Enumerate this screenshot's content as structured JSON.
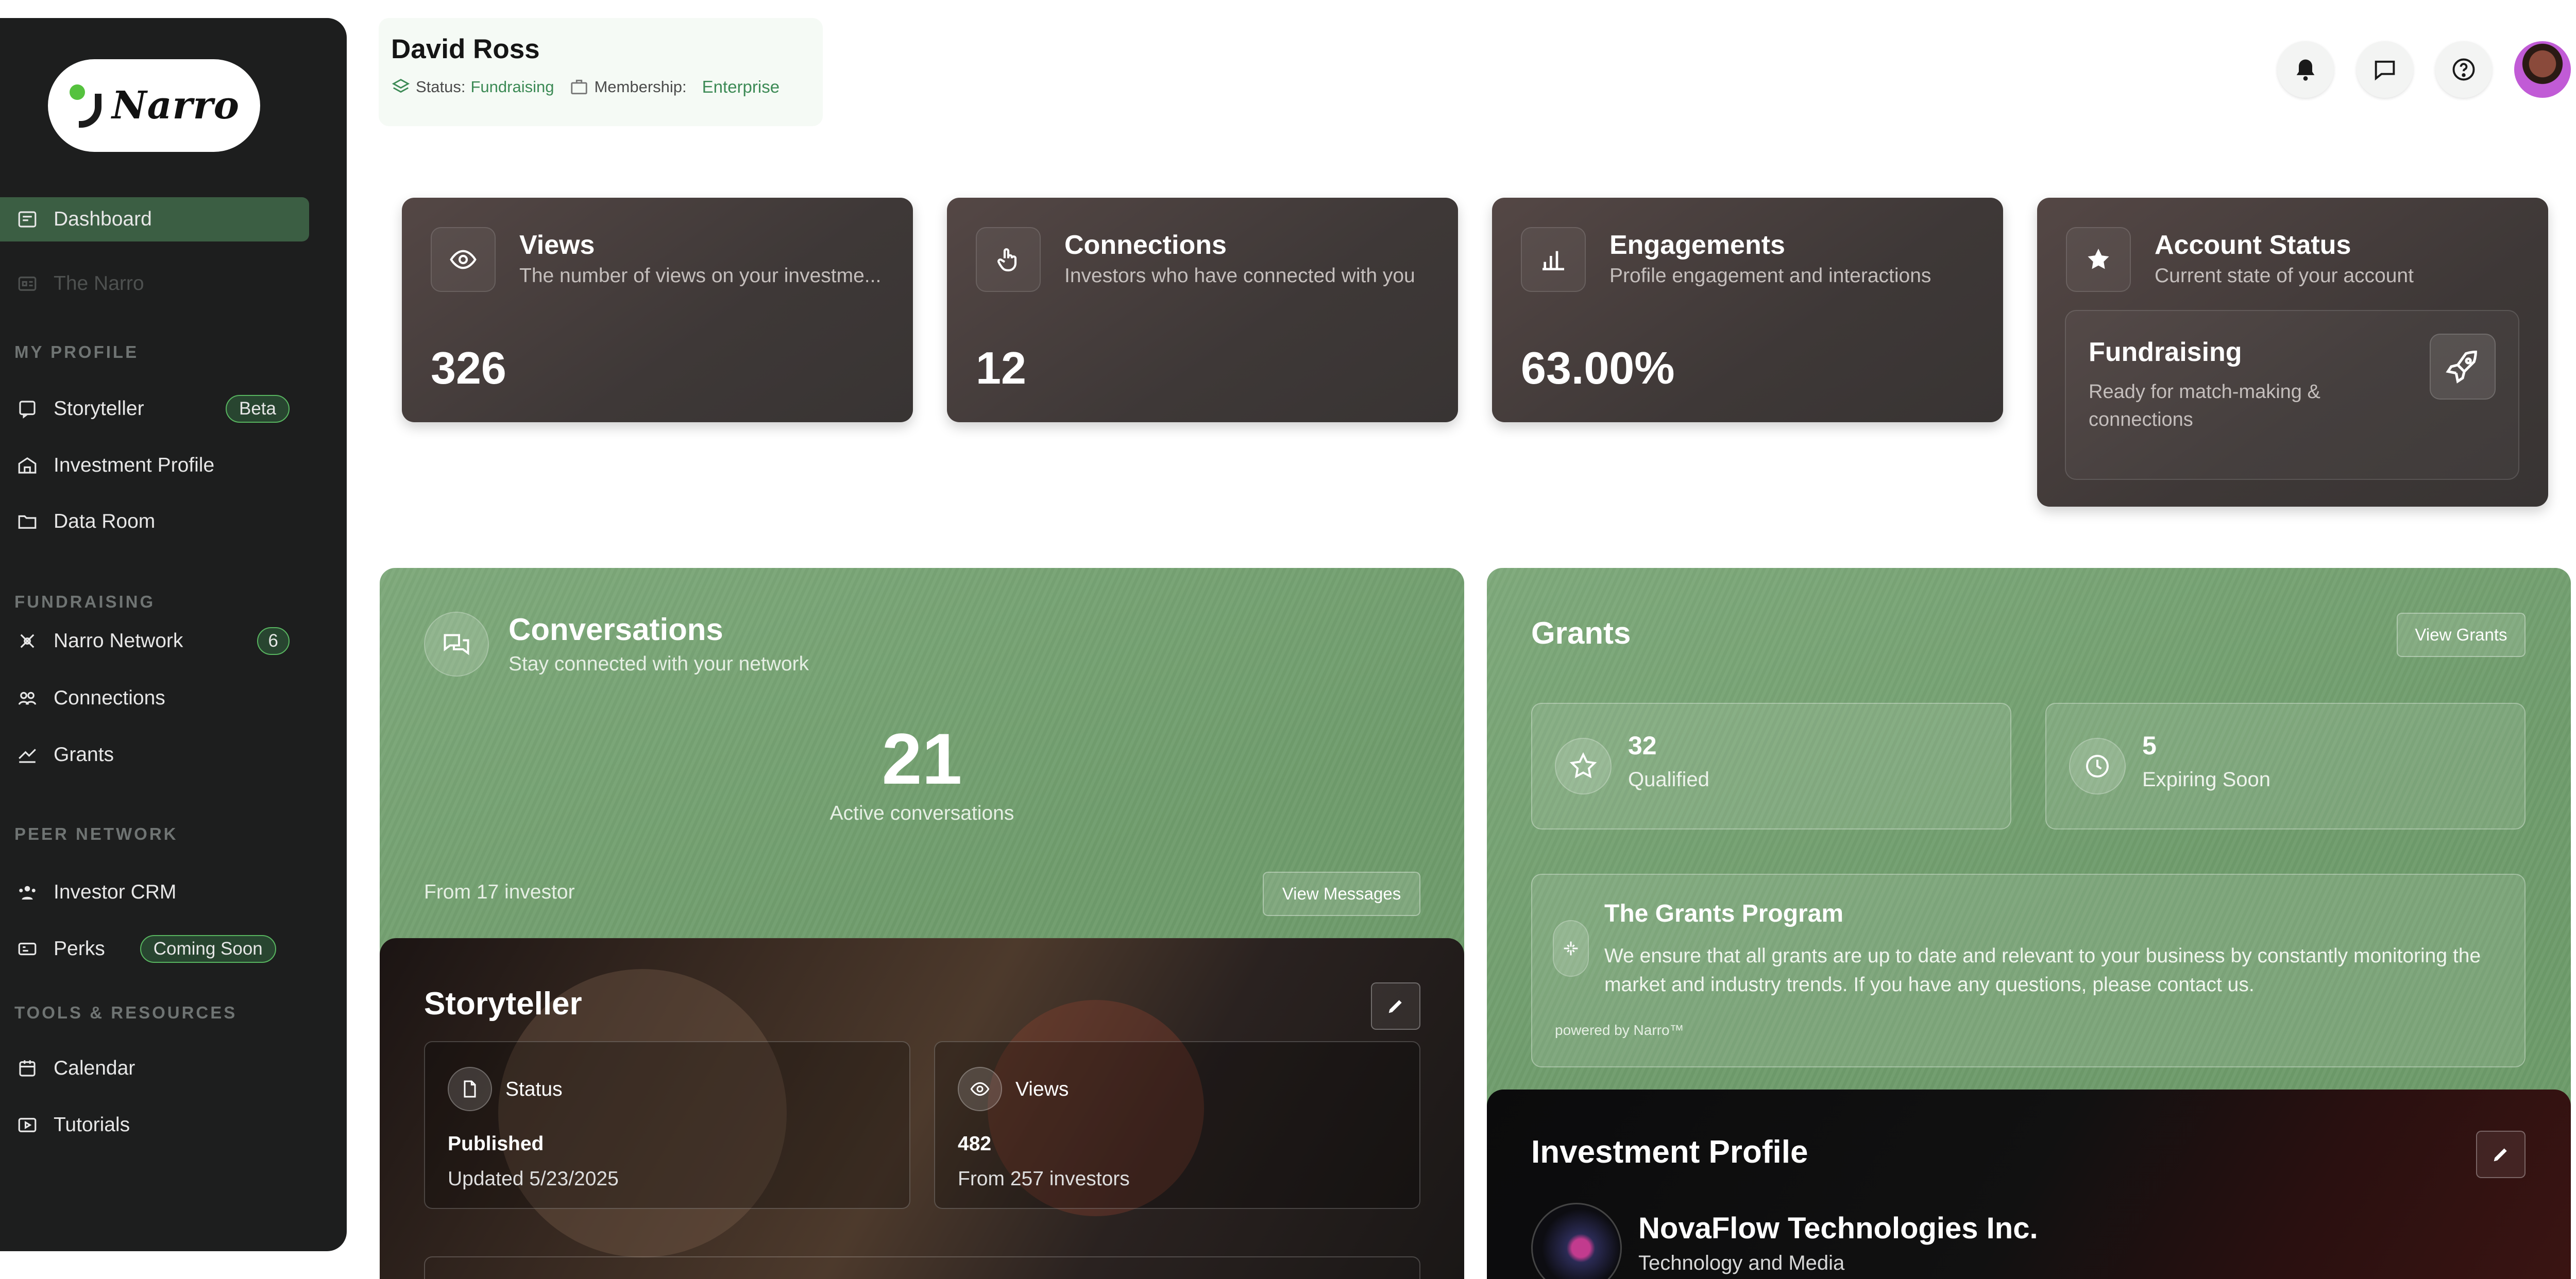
{
  "app": {
    "brand": "Narro"
  },
  "sidebar": {
    "nav": [
      {
        "label": "Dashboard",
        "icon": "dashboard-icon"
      },
      {
        "label": "The Narro",
        "icon": "narro-icon"
      }
    ],
    "sections": [
      {
        "title": "MY PROFILE",
        "items": [
          {
            "label": "Storyteller",
            "icon": "storyteller-icon",
            "badge": "Beta"
          },
          {
            "label": "Investment Profile",
            "icon": "building-icon"
          },
          {
            "label": "Data Room",
            "icon": "folder-icon"
          }
        ]
      },
      {
        "title": "FUNDRAISING",
        "items": [
          {
            "label": "Narro Network",
            "icon": "network-icon",
            "badge": "6"
          },
          {
            "label": "Connections",
            "icon": "connections-icon"
          },
          {
            "label": "Grants",
            "icon": "grants-icon"
          }
        ]
      },
      {
        "title": "PEER NETWORK",
        "items": [
          {
            "label": "Investor CRM",
            "icon": "crm-icon"
          },
          {
            "label": "Perks",
            "icon": "perks-icon",
            "badge": "Coming Soon"
          }
        ]
      },
      {
        "title": "TOOLS & RESOURCES",
        "items": [
          {
            "label": "Calendar",
            "icon": "calendar-icon"
          },
          {
            "label": "Tutorials",
            "icon": "tutorials-icon"
          }
        ]
      }
    ]
  },
  "header": {
    "name": "David Ross",
    "status_label": "Status:",
    "status_value": "Fundraising",
    "membership_label": "Membership:",
    "membership_value": "Enterprise",
    "icons": [
      "bell-icon",
      "chat-icon",
      "help-icon"
    ]
  },
  "stats": [
    {
      "title": "Views",
      "desc": "The number of views on your investme...",
      "value": "326",
      "icon": "eye-icon"
    },
    {
      "title": "Connections",
      "desc": "Investors who have connected with you",
      "value": "12",
      "icon": "hand-pointer-icon"
    },
    {
      "title": "Engagements",
      "desc": "Profile engagement and interactions",
      "value": "63.00%",
      "icon": "bar-chart-icon"
    }
  ],
  "account": {
    "title": "Account Status",
    "desc": "Current state of your account",
    "state_title": "Fundraising",
    "state_desc": "Ready for match-making & connections"
  },
  "conversations": {
    "title": "Conversations",
    "subtitle": "Stay connected with your network",
    "count": "21",
    "count_label": "Active conversations",
    "footer": "From 17 investor",
    "button": "View Messages"
  },
  "grants": {
    "title": "Grants",
    "button": "View Grants",
    "qualified_value": "32",
    "qualified_label": "Qualified",
    "expiring_value": "5",
    "expiring_label": "Expiring Soon",
    "program_title": "The Grants Program",
    "program_text": "We ensure that all grants are up to date and relevant to your business by constantly monitoring the market and industry trends. If you have any questions, please contact us.",
    "powered": "powered by Narro™"
  },
  "storyteller": {
    "title": "Storyteller",
    "status_label": "Status",
    "status_value": "Published",
    "status_updated": "Updated 5/23/2025",
    "views_label": "Views",
    "views_value": "482",
    "views_from": "From 257 investors"
  },
  "investment_profile": {
    "title": "Investment Profile",
    "company": "NovaFlow Technologies Inc.",
    "industry": "Technology and Media"
  },
  "colors": {
    "accent_green": "#3b5e43",
    "panel_green": "#6f9c6c",
    "sidebar_bg": "#1d1e1e",
    "stat_card": "#3e3837"
  }
}
